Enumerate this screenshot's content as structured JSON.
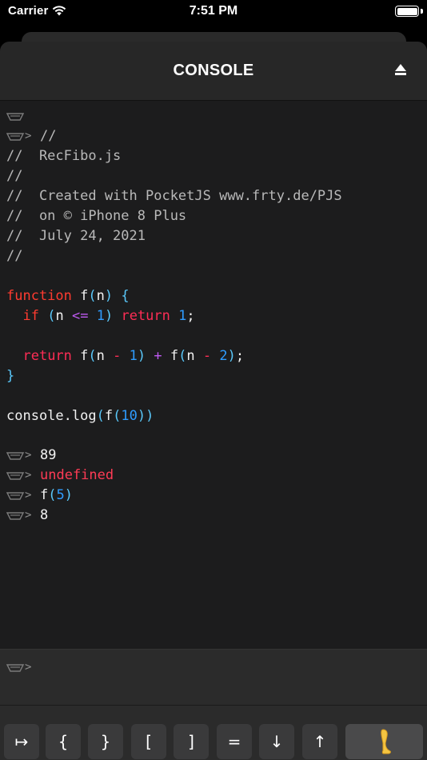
{
  "status_bar": {
    "carrier": "Carrier",
    "time": "7:51 PM"
  },
  "header": {
    "title": "CONSOLE"
  },
  "console": {
    "prompt_arrow": ">",
    "code": {
      "c1": "//",
      "c2": "//  RecFibo.js",
      "c3": "//",
      "c4": "//  Created with PocketJS www.frty.de/PJS",
      "c5": "//  on © iPhone 8 Plus",
      "c6": "//  July 24, 2021",
      "c7": "//",
      "kw_function": "function",
      "fn_name": "f",
      "lparen": "(",
      "rparen": ")",
      "param": "n",
      "brace_open": "{",
      "brace_close": "}",
      "kw_if": "if",
      "op_le": "<=",
      "num_1": "1",
      "kw_return": "return",
      "semi": ";",
      "op_minus": "-",
      "op_plus": "+",
      "num_2": "2",
      "console_log": "console.log",
      "num_10": "10"
    },
    "outputs": [
      "89",
      "undefined",
      "f",
      "5",
      "8"
    ]
  },
  "input": {
    "prompt_arrow": ">",
    "value": ""
  },
  "keybar": {
    "keys": [
      "↦",
      "{",
      "}",
      "[",
      "]",
      "=",
      "↓",
      "↑"
    ],
    "special_key": "leg-icon"
  },
  "colors": {
    "keyword": "#ff3b30",
    "return": "#ff2d55",
    "paren": "#5ac8fa",
    "number": "#2f9cff",
    "comment": "#b9b9b9",
    "undefined": "#ff3b55"
  }
}
